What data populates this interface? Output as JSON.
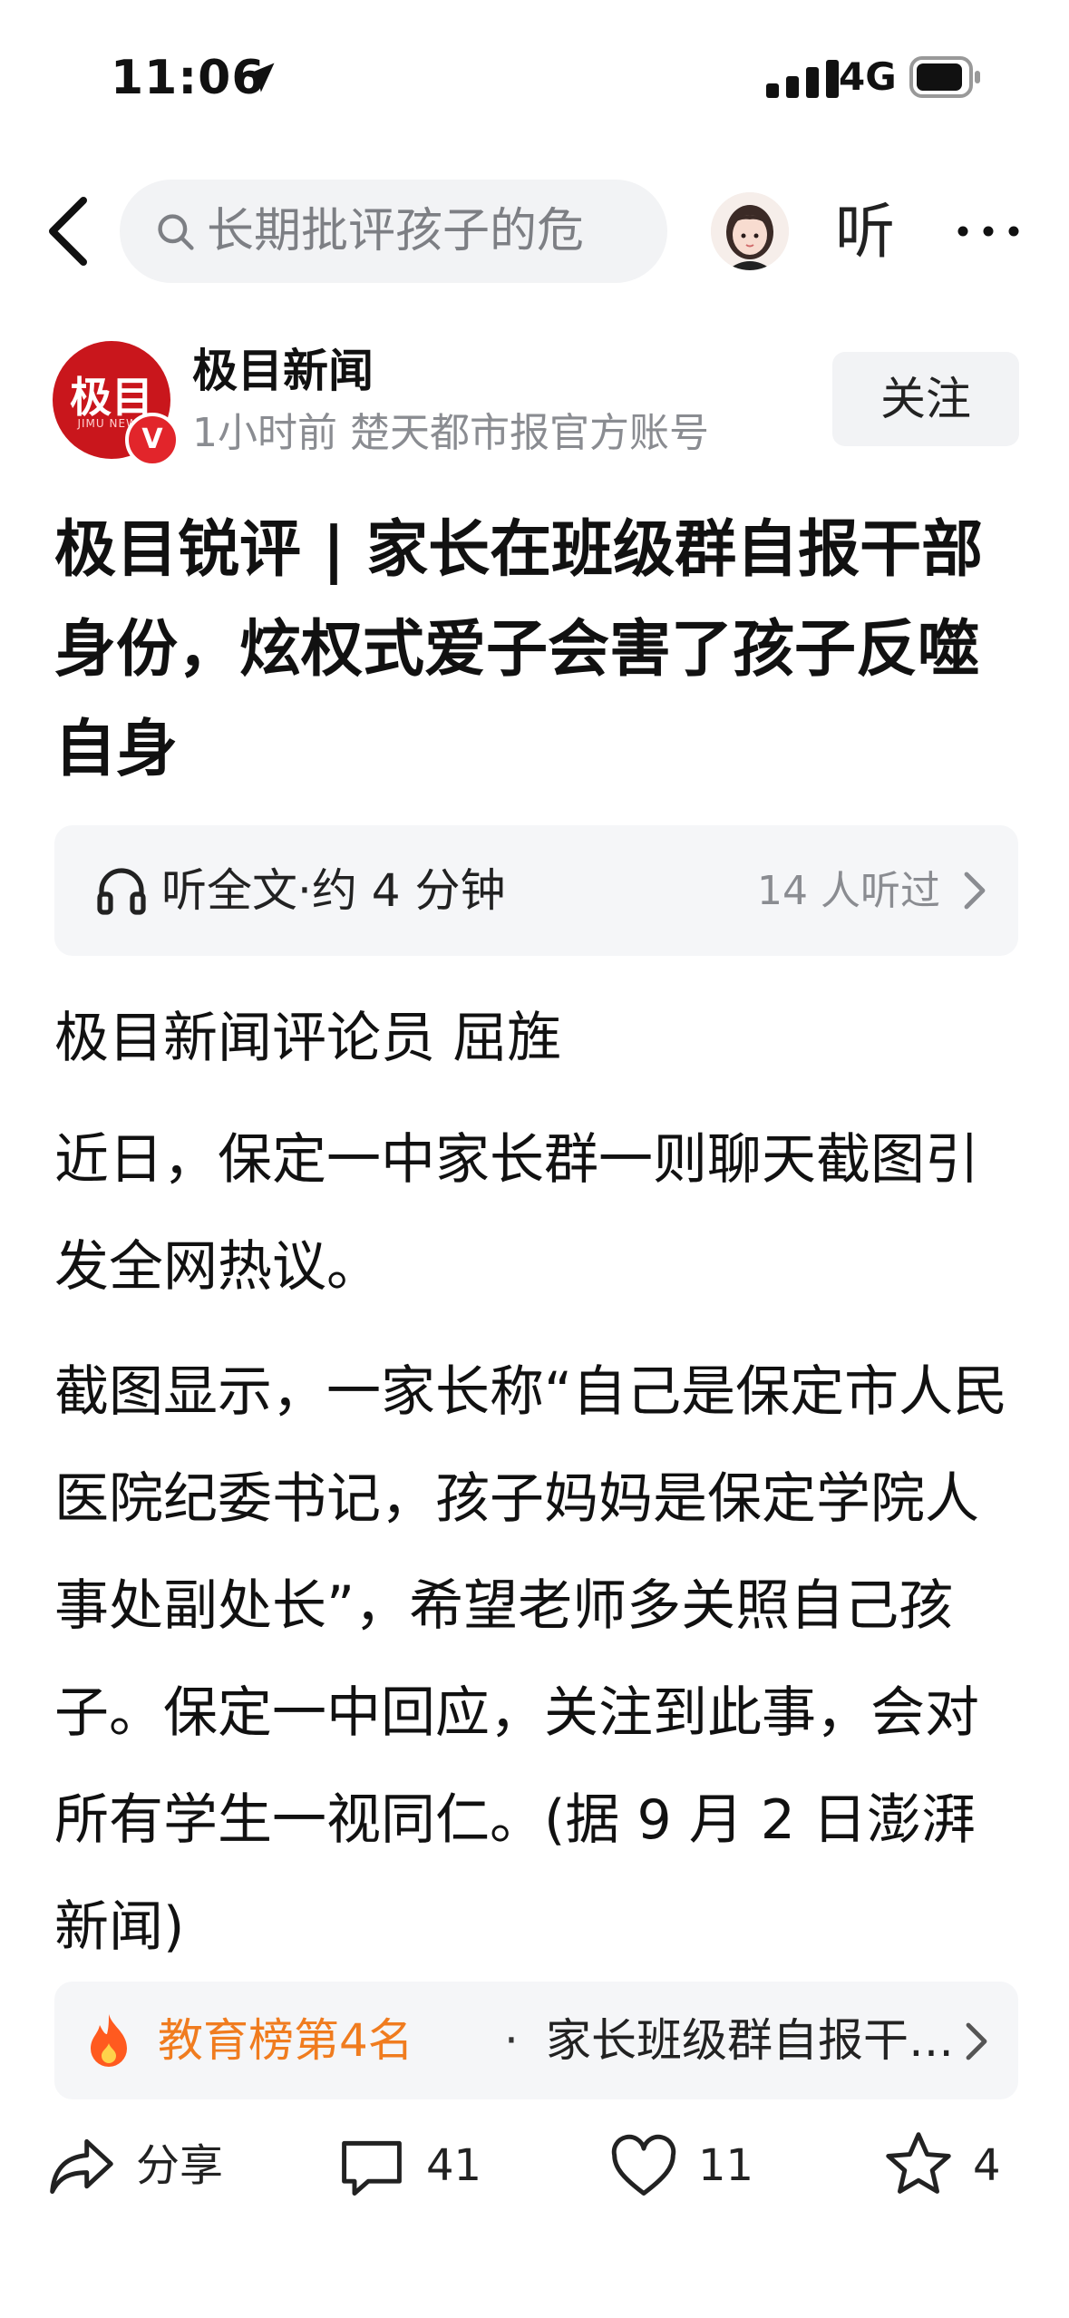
{
  "status_bar": {
    "time": "11:06",
    "network": "4G"
  },
  "nav": {
    "search_text": "长期批评孩子的危",
    "listen_label": "听"
  },
  "author": {
    "logo_text": "极目",
    "logo_sub": "JIMU NEWS",
    "verify_badge": "V",
    "name": "极目新闻",
    "meta": "1小时前  楚天都市报官方账号",
    "follow_label": "关注"
  },
  "article": {
    "title": "极目锐评 | 家长在班级群自报干部身份，炫权式爱子会害了孩子反噬自身",
    "listen_full": "听全文·约 4 分钟",
    "listen_count": "14 人听过",
    "byline": "极目新闻评论员 屈旌",
    "paragraphs": [
      "近日，保定一中家长群一则聊天截图引发全网热议。",
      "截图显示，一家长称“自己是保定市人民医院纪委书记，孩子妈妈是保定学院人事处副处长”，希望老师多关照自己孩子。保定一中回应，关注到此事，会对所有学生一视同仁。(据 9 月 2 日澎湃新闻)"
    ]
  },
  "hot": {
    "rank": "教育榜第4名",
    "separator": "·",
    "title": "家长班级群自报干部身份"
  },
  "actions": {
    "share": "分享",
    "comments": "41",
    "likes": "11",
    "favorites": "4"
  },
  "colors": {
    "accent_orange": "#f07c1f",
    "brand_red": "#c9161c",
    "muted_gray": "#8a8c91"
  }
}
